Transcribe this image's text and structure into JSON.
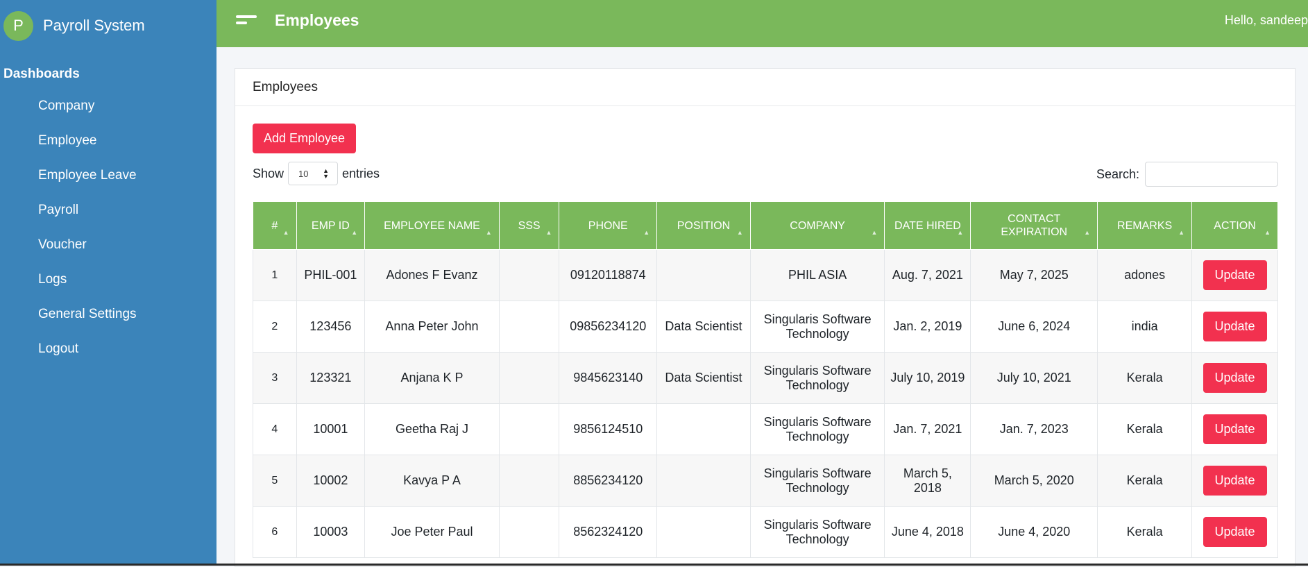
{
  "sidebar": {
    "logo_letter": "P",
    "app_name": "Payroll System",
    "section_title": "Dashboards",
    "items": [
      {
        "label": "Company"
      },
      {
        "label": "Employee"
      },
      {
        "label": "Employee Leave"
      },
      {
        "label": "Payroll"
      },
      {
        "label": "Voucher"
      },
      {
        "label": "Logs"
      },
      {
        "label": "General Settings"
      },
      {
        "label": "Logout"
      }
    ]
  },
  "topbar": {
    "title": "Employees",
    "greeting": "Hello, sandeep"
  },
  "card": {
    "title": "Employees",
    "add_button": "Add Employee",
    "show_label": "Show",
    "entries_value": "10",
    "entries_label": "entries",
    "search_label": "Search:",
    "search_value": ""
  },
  "table": {
    "headers": [
      "#",
      "EMP ID",
      "EMPLOYEE NAME",
      "SSS",
      "PHONE",
      "POSITION",
      "COMPANY",
      "DATE HIRED",
      "CONTACT EXPIRATION",
      "REMARKS",
      "ACTION"
    ],
    "rows": [
      {
        "num": "1",
        "emp_id": "PHIL-001",
        "name": "Adones F Evanz",
        "sss": "",
        "phone": "09120118874",
        "position": "",
        "company": "PHIL ASIA",
        "date_hired": "Aug. 7, 2021",
        "contact_expiration": "May 7, 2025",
        "remarks": "adones",
        "action": "Update"
      },
      {
        "num": "2",
        "emp_id": "123456",
        "name": "Anna Peter John",
        "sss": "",
        "phone": "09856234120",
        "position": "Data Scientist",
        "company": "Singularis Software Technology",
        "date_hired": "Jan. 2, 2019",
        "contact_expiration": "June 6, 2024",
        "remarks": "india",
        "action": "Update"
      },
      {
        "num": "3",
        "emp_id": "123321",
        "name": "Anjana K P",
        "sss": "",
        "phone": "9845623140",
        "position": "Data Scientist",
        "company": "Singularis Software Technology",
        "date_hired": "July 10, 2019",
        "contact_expiration": "July 10, 2021",
        "remarks": "Kerala",
        "action": "Update"
      },
      {
        "num": "4",
        "emp_id": "10001",
        "name": "Geetha Raj J",
        "sss": "",
        "phone": "9856124510",
        "position": "",
        "company": "Singularis Software Technology",
        "date_hired": "Jan. 7, 2021",
        "contact_expiration": "Jan. 7, 2023",
        "remarks": "Kerala",
        "action": "Update"
      },
      {
        "num": "5",
        "emp_id": "10002",
        "name": "Kavya P A",
        "sss": "",
        "phone": "8856234120",
        "position": "",
        "company": "Singularis Software Technology",
        "date_hired": "March 5, 2018",
        "contact_expiration": "March 5, 2020",
        "remarks": "Kerala",
        "action": "Update"
      },
      {
        "num": "6",
        "emp_id": "10003",
        "name": "Joe Peter Paul",
        "sss": "",
        "phone": "8562324120",
        "position": "",
        "company": "Singularis Software Technology",
        "date_hired": "June 4, 2018",
        "contact_expiration": "June 4, 2020",
        "remarks": "Kerala",
        "action": "Update"
      }
    ]
  },
  "colors": {
    "sidebar_bg": "#3b84ba",
    "topbar_bg": "#7ab85b",
    "table_header_bg": "#7ab85b",
    "danger_button": "#f2314f"
  },
  "icons": {
    "menu": "hamburger-icon",
    "sort": "sort-icon",
    "select_arrows": "chevron-updown-icon"
  }
}
